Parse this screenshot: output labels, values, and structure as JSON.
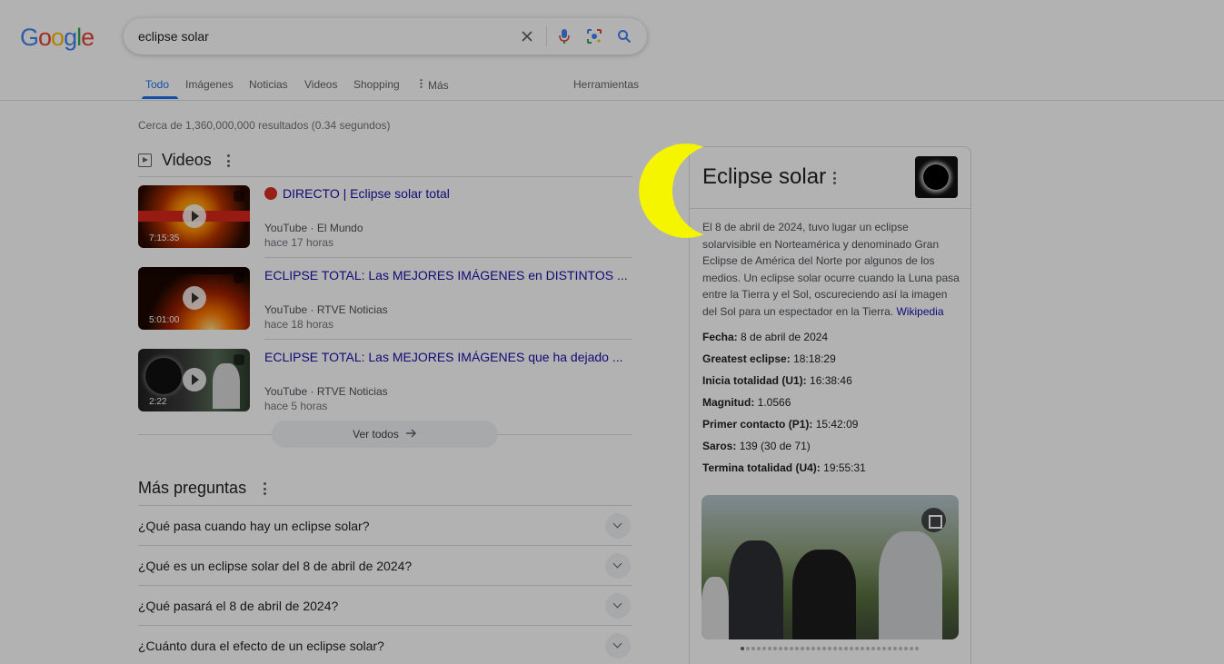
{
  "header": {
    "logo_letters": [
      {
        "ch": "G",
        "color": "#4285f4"
      },
      {
        "ch": "o",
        "color": "#ea4335"
      },
      {
        "ch": "o",
        "color": "#fbbc05"
      },
      {
        "ch": "g",
        "color": "#4285f4"
      },
      {
        "ch": "l",
        "color": "#34a853"
      },
      {
        "ch": "e",
        "color": "#ea4335"
      }
    ],
    "search": {
      "query": "eclipse solar"
    },
    "tabs": [
      "Todo",
      "Imágenes",
      "Noticias",
      "Videos",
      "Shopping",
      "Más"
    ],
    "tools": "Herramientas"
  },
  "result_stats": "Cerca de 1,360,000,000 resultados (0.34 segundos)",
  "videos": {
    "heading": "Videos",
    "items": [
      {
        "title": "DIRECTO | Eclipse solar total",
        "source": "YouTube",
        "channel": "El Mundo",
        "age": "hace 17 horas",
        "duration": "7:15:35"
      },
      {
        "title": "ECLIPSE TOTAL: Las MEJORES IMÁGENES en DISTINTOS ...",
        "source": "YouTube",
        "channel": "RTVE Noticias",
        "age": "hace 18 horas",
        "duration": "5:01:00"
      },
      {
        "title": "ECLIPSE TOTAL: Las MEJORES IMÁGENES que ha dejado ...",
        "source": "YouTube",
        "channel": "RTVE Noticias",
        "age": "hace 5 horas",
        "duration": "2:22"
      }
    ],
    "see_all": "Ver todos"
  },
  "paa": {
    "heading": "Más preguntas",
    "questions": [
      "¿Qué pasa cuando hay un eclipse solar?",
      "¿Qué es un eclipse solar del 8 de abril de 2024?",
      "¿Qué pasará el 8 de abril de 2024?",
      "¿Cuánto dura el efecto de un eclipse solar?"
    ]
  },
  "knowledge_panel": {
    "title": "Eclipse solar",
    "description": "El 8 de abril de 2024, tuvo lugar un eclipse solarvisible en Norteamérica y denominado Gran Eclipse de América del Norte por algunos de los medios. Un eclipse solar ocurre cuando la Luna pasa entre la Tierra y el Sol, oscureciendo así la imagen del Sol para un espectador en la Tierra.",
    "source_link": "Wikipedia",
    "facts": [
      {
        "label": "Fecha:",
        "value": "8 de abril de 2024"
      },
      {
        "label": "Greatest eclipse:",
        "value": "18:18:29"
      },
      {
        "label": "Inicia totalidad (U1):",
        "value": "16:38:46"
      },
      {
        "label": "Magnitud:",
        "value": "1.0566"
      },
      {
        "label": "Primer contacto (P1):",
        "value": "15:42:09"
      },
      {
        "label": "Saros:",
        "value": "139 (30 de 71)"
      },
      {
        "label": "Termina totalidad (U4):",
        "value": "19:55:31"
      }
    ]
  },
  "colors": {
    "link": "#1a0dab",
    "accent": "#1a73e8",
    "highlight": "#f5f500"
  }
}
